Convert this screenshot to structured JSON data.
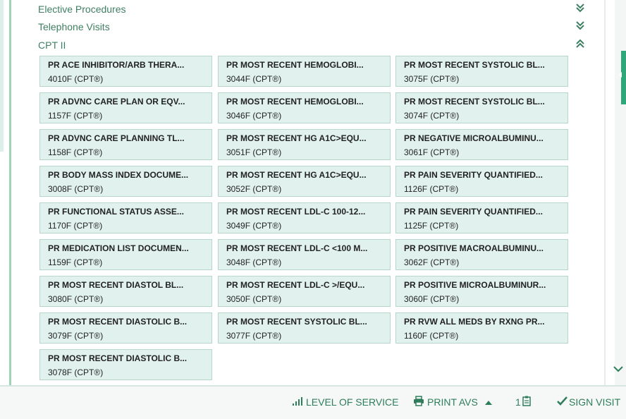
{
  "sections": [
    {
      "label": "Elective Procedures",
      "state": "collapsed",
      "icon": "double-chevron-down-icon"
    },
    {
      "label": "Telephone Visits",
      "state": "collapsed",
      "icon": "double-chevron-down-icon"
    },
    {
      "label": "CPT II",
      "state": "expanded",
      "icon": "double-chevron-up-icon"
    }
  ],
  "tiles": [
    {
      "name": "PR ACE INHIBITOR/ARB THERA...",
      "code": "4010F (CPT®)"
    },
    {
      "name": "PR MOST RECENT HEMOGLOBI...",
      "code": "3044F (CPT®)"
    },
    {
      "name": "PR MOST RECENT SYSTOLIC BL...",
      "code": "3075F (CPT®)"
    },
    {
      "name": "PR ADVNC CARE PLAN OR EQV...",
      "code": "1157F (CPT®)"
    },
    {
      "name": "PR MOST RECENT HEMOGLOBI...",
      "code": "3046F (CPT®)"
    },
    {
      "name": "PR MOST RECENT SYSTOLIC BL...",
      "code": "3074F (CPT®)"
    },
    {
      "name": "PR ADVNC CARE PLANNING TL...",
      "code": "1158F (CPT®)"
    },
    {
      "name": "PR MOST RECENT HG A1C>EQU...",
      "code": "3051F (CPT®)"
    },
    {
      "name": "PR NEGATIVE MICROALBUMINU...",
      "code": "3061F (CPT®)"
    },
    {
      "name": "PR BODY MASS INDEX DOCUME...",
      "code": "3008F (CPT®)"
    },
    {
      "name": "PR MOST RECENT HG A1C>EQU...",
      "code": "3052F (CPT®)"
    },
    {
      "name": "PR PAIN SEVERITY QUANTIFIED...",
      "code": "1126F (CPT®)"
    },
    {
      "name": "PR FUNCTIONAL STATUS ASSE...",
      "code": "1170F (CPT®)"
    },
    {
      "name": "PR MOST RECENT LDL-C 100-12...",
      "code": "3049F (CPT®)"
    },
    {
      "name": "PR PAIN SEVERITY QUANTIFIED...",
      "code": "1125F (CPT®)"
    },
    {
      "name": "PR MEDICATION LIST DOCUMEN...",
      "code": "1159F (CPT®)"
    },
    {
      "name": "PR MOST RECENT LDL-C <100 M...",
      "code": "3048F (CPT®)"
    },
    {
      "name": "PR POSITIVE MACROALBUMINU...",
      "code": "3062F (CPT®)"
    },
    {
      "name": "PR MOST RECENT DIASTOL BL...",
      "code": "3080F (CPT®)"
    },
    {
      "name": "PR MOST RECENT LDL-C >/EQU...",
      "code": "3050F (CPT®)"
    },
    {
      "name": "PR POSITIVE MICROALBUMINUR...",
      "code": "3060F (CPT®)"
    },
    {
      "name": "PR MOST RECENT DIASTOLIC B...",
      "code": "3079F (CPT®)"
    },
    {
      "name": "PR MOST RECENT SYSTOLIC BL...",
      "code": "3077F (CPT®)"
    },
    {
      "name": "PR RVW ALL MEDS BY RXNG PR...",
      "code": "1160F (CPT®)"
    },
    {
      "name": "PR MOST RECENT DIASTOLIC B...",
      "code": "3078F (CPT®)"
    }
  ],
  "footer": {
    "level_of_service": {
      "label": "LEVEL OF SERVICE",
      "icon": "bar-chart-icon"
    },
    "print_avs": {
      "label": "PRINT AVS",
      "icon": "printer-icon",
      "caret_icon": "caret-up-icon"
    },
    "clipboard": {
      "count": "1",
      "icon": "clipboard-icon"
    },
    "sign_visit": {
      "label": "SIGN VISIT",
      "icon": "checkmark-icon"
    }
  },
  "colors": {
    "accent": "#2e7d5b",
    "tile_bg": "#e1f2ee",
    "tile_border": "#b6d6cd",
    "section_text": "#3f7f63"
  }
}
